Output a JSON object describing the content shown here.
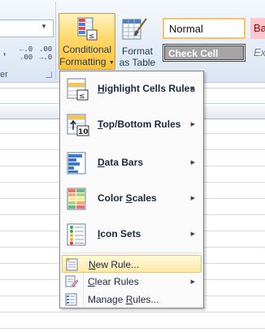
{
  "ribbon": {
    "number_group_label": "er",
    "decimal_increase": ".00",
    "decimal_decrease": ".00",
    "decimal_increase_top": "←.0",
    "decimal_decrease_top": ".00",
    "comma_symbol": ",",
    "conditional_formatting": {
      "line1": "Conditional",
      "line2": "Formatting"
    },
    "format_as_table": {
      "line1": "Format",
      "line2": "as Table"
    },
    "cell_styles": {
      "normal": "Normal",
      "bad": "Ba",
      "check_cell": "Check Cell",
      "explanatory": "Ex"
    }
  },
  "menu": {
    "items": [
      {
        "label": "Highlight Cells Rules",
        "accel": "H",
        "icon": "highlight-cells-rules-icon",
        "has_submenu": true
      },
      {
        "label": "Top/Bottom Rules",
        "accel": "T",
        "icon": "top-bottom-rules-icon",
        "has_submenu": true
      },
      {
        "label": "Data Bars",
        "accel": "D",
        "icon": "data-bars-icon",
        "has_submenu": true
      },
      {
        "label": "Color Scales",
        "accel": "S",
        "icon": "color-scales-icon",
        "has_submenu": true
      },
      {
        "label": "Icon Sets",
        "accel": "I",
        "icon": "icon-sets-icon",
        "has_submenu": true
      }
    ],
    "small_items": [
      {
        "label": "New Rule...",
        "accel": "N",
        "icon": "new-rule-icon",
        "has_submenu": false,
        "highlighted": true
      },
      {
        "label": "Clear Rules",
        "accel": "C",
        "icon": "clear-rules-icon",
        "has_submenu": true,
        "highlighted": false
      },
      {
        "label": "Manage Rules...",
        "accel": "R",
        "icon": "manage-rules-icon",
        "has_submenu": false,
        "highlighted": false
      }
    ]
  },
  "colors": {
    "active_button": "#ffd869",
    "menu_highlight": "#ffe9a8",
    "bad_style_bg": "#ffc7ce",
    "check_cell_bg": "#a5a5a5"
  }
}
